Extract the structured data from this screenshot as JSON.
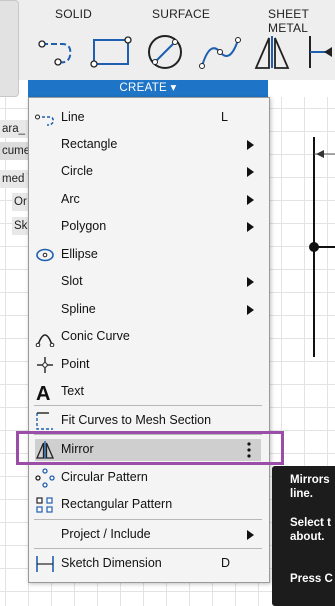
{
  "toolbar": {
    "tabs": [
      "SOLID",
      "SURFACE",
      "SHEET METAL"
    ],
    "create_label": "CREATE ▾",
    "tools": [
      "line-icon",
      "rectangle-icon",
      "circle-icon",
      "spline-icon",
      "mirror-icon",
      "constraint-icon"
    ]
  },
  "browser": {
    "rows": [
      "ara_",
      "cume",
      "med V",
      "Or",
      "Sk"
    ]
  },
  "menu": {
    "items": [
      {
        "label": "Line",
        "shortcut": "L",
        "icon": "line-icon",
        "submenu": false
      },
      {
        "label": "Rectangle",
        "shortcut": "",
        "icon": "",
        "submenu": true
      },
      {
        "label": "Circle",
        "shortcut": "",
        "icon": "",
        "submenu": true
      },
      {
        "label": "Arc",
        "shortcut": "",
        "icon": "",
        "submenu": true
      },
      {
        "label": "Polygon",
        "shortcut": "",
        "icon": "",
        "submenu": true
      },
      {
        "label": "Ellipse",
        "shortcut": "",
        "icon": "ellipse-icon",
        "submenu": false
      },
      {
        "label": "Slot",
        "shortcut": "",
        "icon": "",
        "submenu": true
      },
      {
        "label": "Spline",
        "shortcut": "",
        "icon": "",
        "submenu": true
      },
      {
        "label": "Conic Curve",
        "shortcut": "",
        "icon": "conic-curve-icon",
        "submenu": false
      },
      {
        "label": "Point",
        "shortcut": "",
        "icon": "point-icon",
        "submenu": false
      },
      {
        "label": "Text",
        "shortcut": "",
        "icon": "text-icon",
        "submenu": false
      },
      {
        "label": "Fit Curves to Mesh Section",
        "shortcut": "",
        "icon": "fit-curves-icon",
        "submenu": false
      },
      {
        "label": "Mirror",
        "shortcut": "",
        "icon": "mirror-icon",
        "submenu": false,
        "highlighted": true
      },
      {
        "label": "Circular Pattern",
        "shortcut": "",
        "icon": "circular-pattern-icon",
        "submenu": false
      },
      {
        "label": "Rectangular Pattern",
        "shortcut": "",
        "icon": "rectangular-pattern-icon",
        "submenu": false
      },
      {
        "label": "Project / Include",
        "shortcut": "",
        "icon": "",
        "submenu": true
      },
      {
        "label": "Sketch Dimension",
        "shortcut": "D",
        "icon": "sketch-dimension-icon",
        "submenu": false
      }
    ]
  },
  "tooltip": {
    "line1": "Mirrors",
    "line2": "line.",
    "line3": "Select t",
    "line4": "about.",
    "line5": "Press C"
  },
  "colors": {
    "create_bar": "#1e75c7",
    "highlight_border": "#9b4ea8",
    "tooltip_bg": "#1c1c1c"
  }
}
